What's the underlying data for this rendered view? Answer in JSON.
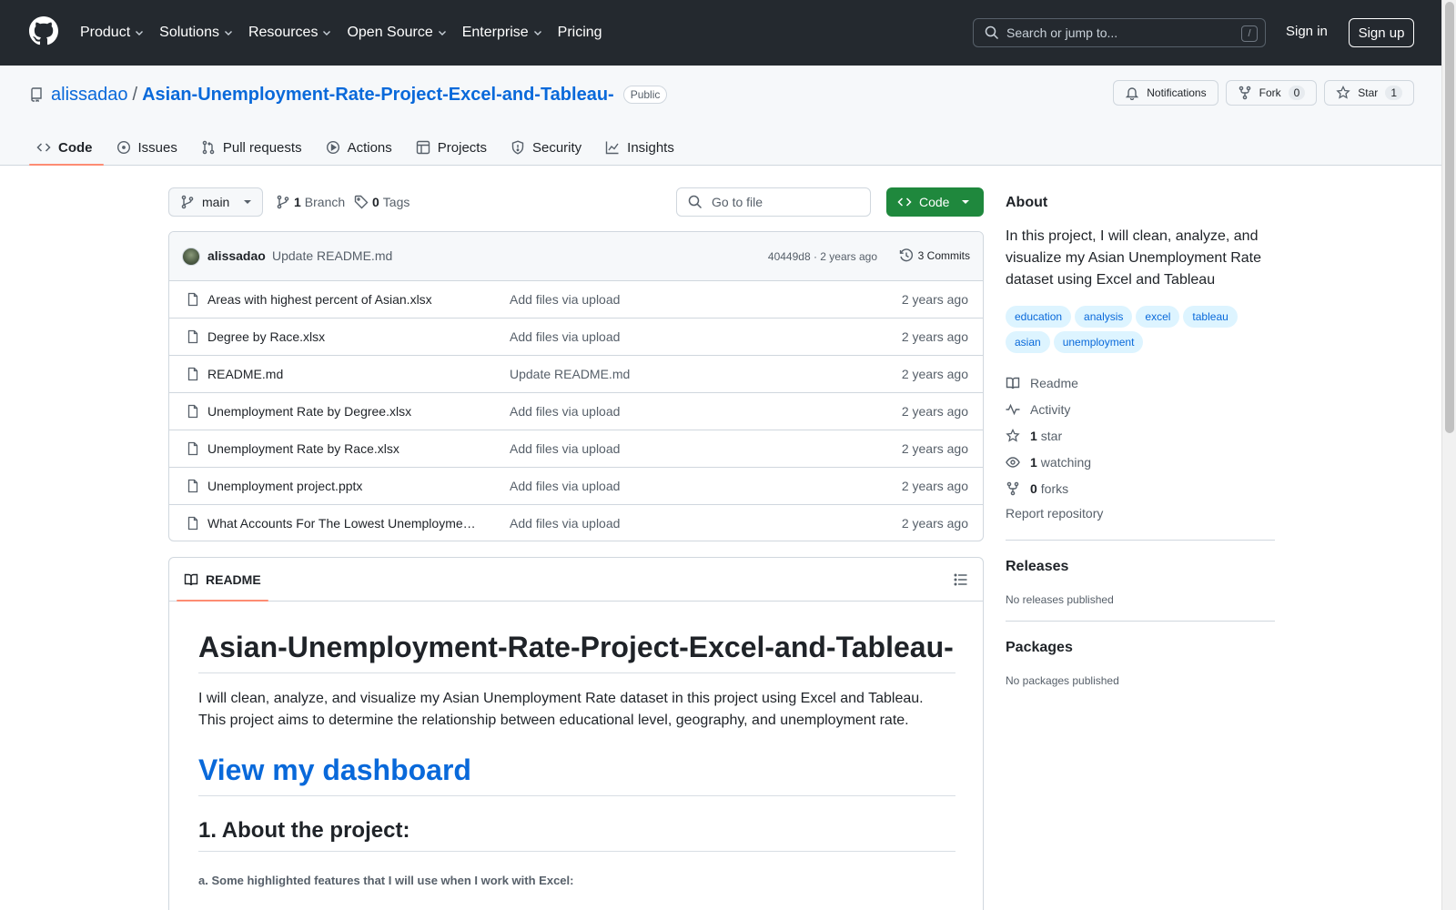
{
  "header": {
    "nav": [
      {
        "label": "Product",
        "dropdown": true
      },
      {
        "label": "Solutions",
        "dropdown": true
      },
      {
        "label": "Resources",
        "dropdown": true
      },
      {
        "label": "Open Source",
        "dropdown": true
      },
      {
        "label": "Enterprise",
        "dropdown": true
      },
      {
        "label": "Pricing",
        "dropdown": false
      }
    ],
    "search_placeholder": "Search or jump to...",
    "search_key": "/",
    "sign_in": "Sign in",
    "sign_up": "Sign up"
  },
  "repo": {
    "owner": "alissadao",
    "separator": "/",
    "name": "Asian-Unemployment-Rate-Project-Excel-and-Tableau-",
    "visibility": "Public",
    "notifications_label": "Notifications",
    "fork_label": "Fork",
    "fork_count": "0",
    "star_label": "Star",
    "star_count": "1",
    "tabs": [
      "Code",
      "Issues",
      "Pull requests",
      "Actions",
      "Projects",
      "Security",
      "Insights"
    ]
  },
  "filebar": {
    "branch": "main",
    "branch_count": "1",
    "branch_label": "Branch",
    "tag_count": "0",
    "tag_label": "Tags",
    "goto_placeholder": "Go to file",
    "code_label": "Code"
  },
  "commit": {
    "author": "alissadao",
    "message": "Update README.md",
    "meta": "40449d8 · 2 years ago",
    "commits_count": "3",
    "commits_label": "Commits"
  },
  "files": [
    {
      "name": "Areas with highest percent of Asian.xlsx",
      "message": "Add files via upload",
      "age": "2 years ago"
    },
    {
      "name": "Degree by Race.xlsx",
      "message": "Add files via upload",
      "age": "2 years ago"
    },
    {
      "name": "README.md",
      "message": "Update README.md",
      "age": "2 years ago"
    },
    {
      "name": "Unemployment Rate by Degree.xlsx",
      "message": "Add files via upload",
      "age": "2 years ago"
    },
    {
      "name": "Unemployment Rate by Race.xlsx",
      "message": "Add files via upload",
      "age": "2 years ago"
    },
    {
      "name": "Unemployment project.pptx",
      "message": "Add files via upload",
      "age": "2 years ago"
    },
    {
      "name": "What Accounts For The Lowest Unemployme…",
      "message": "Add files via upload",
      "age": "2 years ago"
    }
  ],
  "readme": {
    "tab_label": "README",
    "h1": "Asian-Unemployment-Rate-Project-Excel-and-Tableau-",
    "intro_1": "I will clean, analyze, and visualize my Asian Unemployment Rate dataset in this project using Excel and Tableau.",
    "intro_2": "This project aims to determine the relationship between educational level, geography, and unemployment rate.",
    "dashboard_link": "View my dashboard",
    "h2_about": "1. About the project:",
    "h5_features": "a. Some highlighted features that I will use when I work with Excel:"
  },
  "sidebar": {
    "about_title": "About",
    "description": "In this project, I will clean, analyze, and visualize my Asian Unemployment Rate dataset using Excel and Tableau",
    "topics": [
      "education",
      "analysis",
      "excel",
      "tableau",
      "asian",
      "unemployment"
    ],
    "readme_label": "Readme",
    "activity_label": "Activity",
    "stars_count": "1",
    "stars_label": "star",
    "watching_count": "1",
    "watching_label": "watching",
    "forks_count": "0",
    "forks_label": "forks",
    "report_label": "Report repository",
    "releases_title": "Releases",
    "releases_empty": "No releases published",
    "packages_title": "Packages",
    "packages_empty": "No packages published"
  },
  "colors": {
    "header_bg": "#24292f",
    "link": "#0969da",
    "code_button": "#1f883d",
    "tab_underline": "#fd8c73",
    "topic_bg": "#ddf4ff"
  }
}
